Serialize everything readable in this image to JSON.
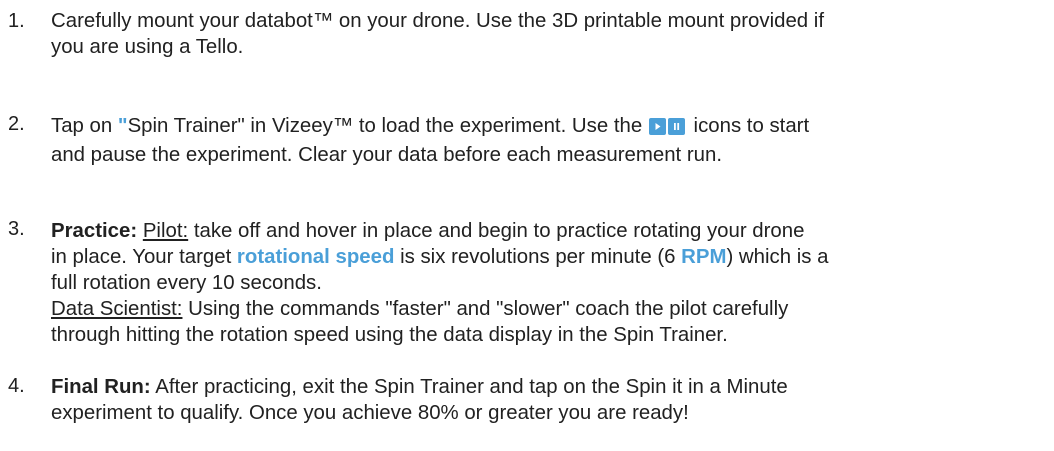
{
  "accent_color": "#4a9fd8",
  "icons": {
    "play": "play-icon",
    "pause": "pause-icon"
  },
  "steps": [
    {
      "number": "1.",
      "line1": "Carefully mount your databot™ on your drone. Use the 3D printable mount provided if",
      "line2": "you are using a Tello."
    },
    {
      "number": "2.",
      "line1_a": "Tap on ",
      "quote_open": "\"",
      "line1_b": "Spin Trainer\" in Vizeey™ to load the experiment. Use the ",
      "line1_c": " icons to start",
      "line2": "and pause the experiment.  Clear your data before each measurement run."
    },
    {
      "number": "3.",
      "practice_label": "Practice:",
      "pilot_label": "Pilot:",
      "line1_rest": " take off and hover in place and begin to practice rotating your drone",
      "line2_a": "in place. Your target ",
      "line2_highlight": "rotational speed",
      "line2_b": " is six revolutions per minute (6 ",
      "line2_rpm": "RPM",
      "line2_c": ") which is a",
      "line3": "full rotation every 10 seconds.",
      "scientist_label": "Data Scientist:",
      "line4_rest": " Using the commands \"faster\" and \"slower\" coach the pilot carefully",
      "line5": "through hitting the rotation speed using the data display in the Spin Trainer."
    },
    {
      "number": "4.",
      "final_label": "Final Run:",
      "line1_rest": " After practicing, exit the Spin Trainer and tap on  the Spin it in a Minute",
      "line2": "experiment to qualify.  Once you achieve 80% or greater you are ready!"
    }
  ]
}
